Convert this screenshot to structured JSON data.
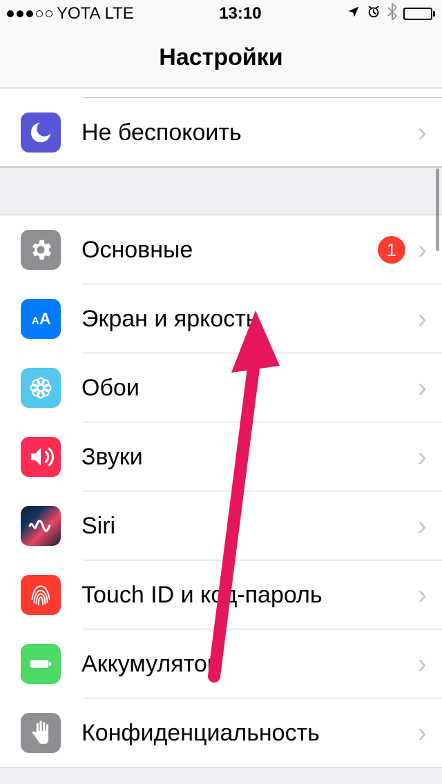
{
  "status": {
    "carrier": "YOTA",
    "network": "LTE",
    "time": "13:10"
  },
  "nav": {
    "title": "Настройки"
  },
  "rows": {
    "dnd": {
      "label": "Не беспокоить"
    },
    "general": {
      "label": "Основные",
      "badge": "1"
    },
    "display": {
      "label": "Экран и яркость"
    },
    "wallpaper": {
      "label": "Обои"
    },
    "sounds": {
      "label": "Звуки"
    },
    "siri": {
      "label": "Siri"
    },
    "touchid": {
      "label": "Touch ID и код-пароль"
    },
    "battery": {
      "label": "Аккумулятор"
    },
    "privacy": {
      "label": "Конфиденциальность"
    }
  },
  "annotation": {
    "color": "#e91e63"
  }
}
